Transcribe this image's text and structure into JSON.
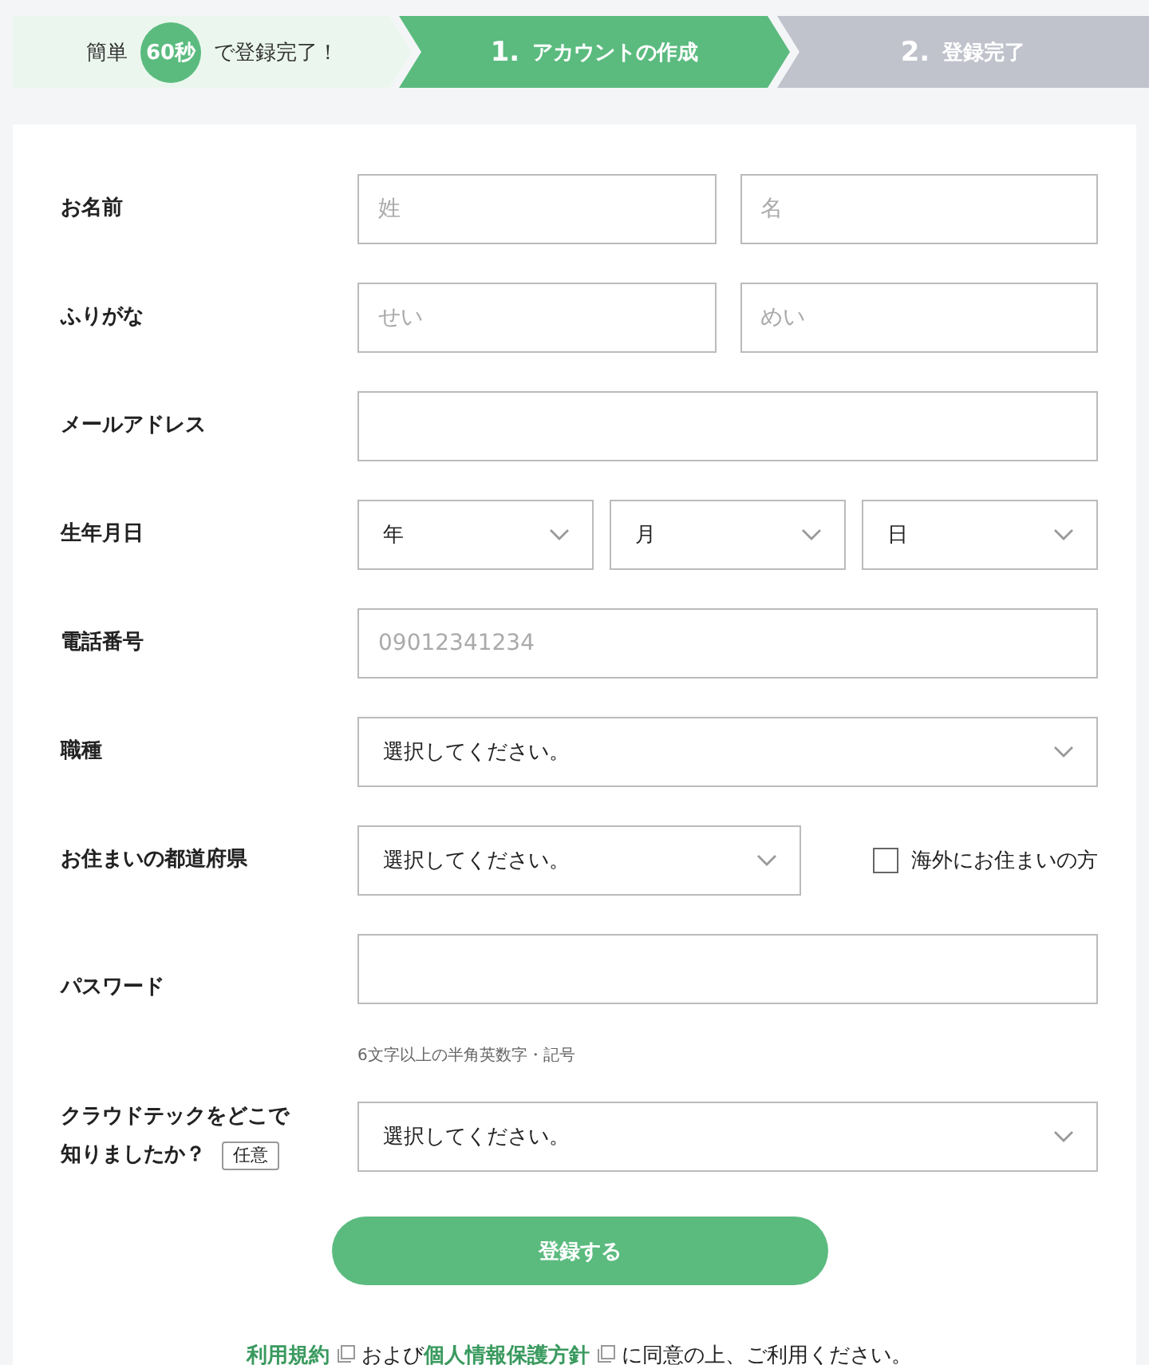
{
  "steps": [
    {
      "kind": "intro",
      "before": "簡単",
      "badge": "60秒",
      "after": "で登録完了！"
    },
    {
      "kind": "step",
      "number": "1.",
      "label": "アカウントの作成",
      "selected": true
    },
    {
      "kind": "step",
      "number": "2.",
      "label": "登録完了",
      "selected": false
    }
  ],
  "fields": [
    {
      "kind": "pair",
      "label": "お名前",
      "inputs": [
        {
          "placeholder": "姓"
        },
        {
          "placeholder": "名"
        }
      ]
    },
    {
      "kind": "pair",
      "label": "ふりがな",
      "inputs": [
        {
          "placeholder": "せい"
        },
        {
          "placeholder": "めい"
        }
      ]
    },
    {
      "kind": "text",
      "label": "メールアドレス"
    },
    {
      "kind": "selects",
      "label": "生年月日",
      "selects": [
        {
          "value": "年"
        },
        {
          "value": "月"
        },
        {
          "value": "日"
        }
      ]
    },
    {
      "kind": "text",
      "label": "電話番号",
      "placeholder": "09012341234"
    },
    {
      "kind": "select",
      "label": "職種",
      "value": "選択してください。"
    },
    {
      "kind": "select_check",
      "label": "お住まいの都道府県",
      "value": "選択してください。",
      "checkbox": {
        "label": "海外にお住まいの方",
        "checked": false
      }
    },
    {
      "kind": "password",
      "label": "パスワード",
      "hint": "6文字以上の半角英数字・記号"
    },
    {
      "kind": "select",
      "label": "クラウドテックをどこで知りましたか？",
      "badge": "任意",
      "value": "選択してください。"
    }
  ],
  "submit": "登録する",
  "consent": [
    {
      "kind": "link",
      "text": "利用規約"
    },
    {
      "kind": "text",
      "text": "および"
    },
    {
      "kind": "link",
      "text": "個人情報保護方針"
    },
    {
      "kind": "text",
      "text": "に同意の上、ご利用ください。"
    }
  ]
}
